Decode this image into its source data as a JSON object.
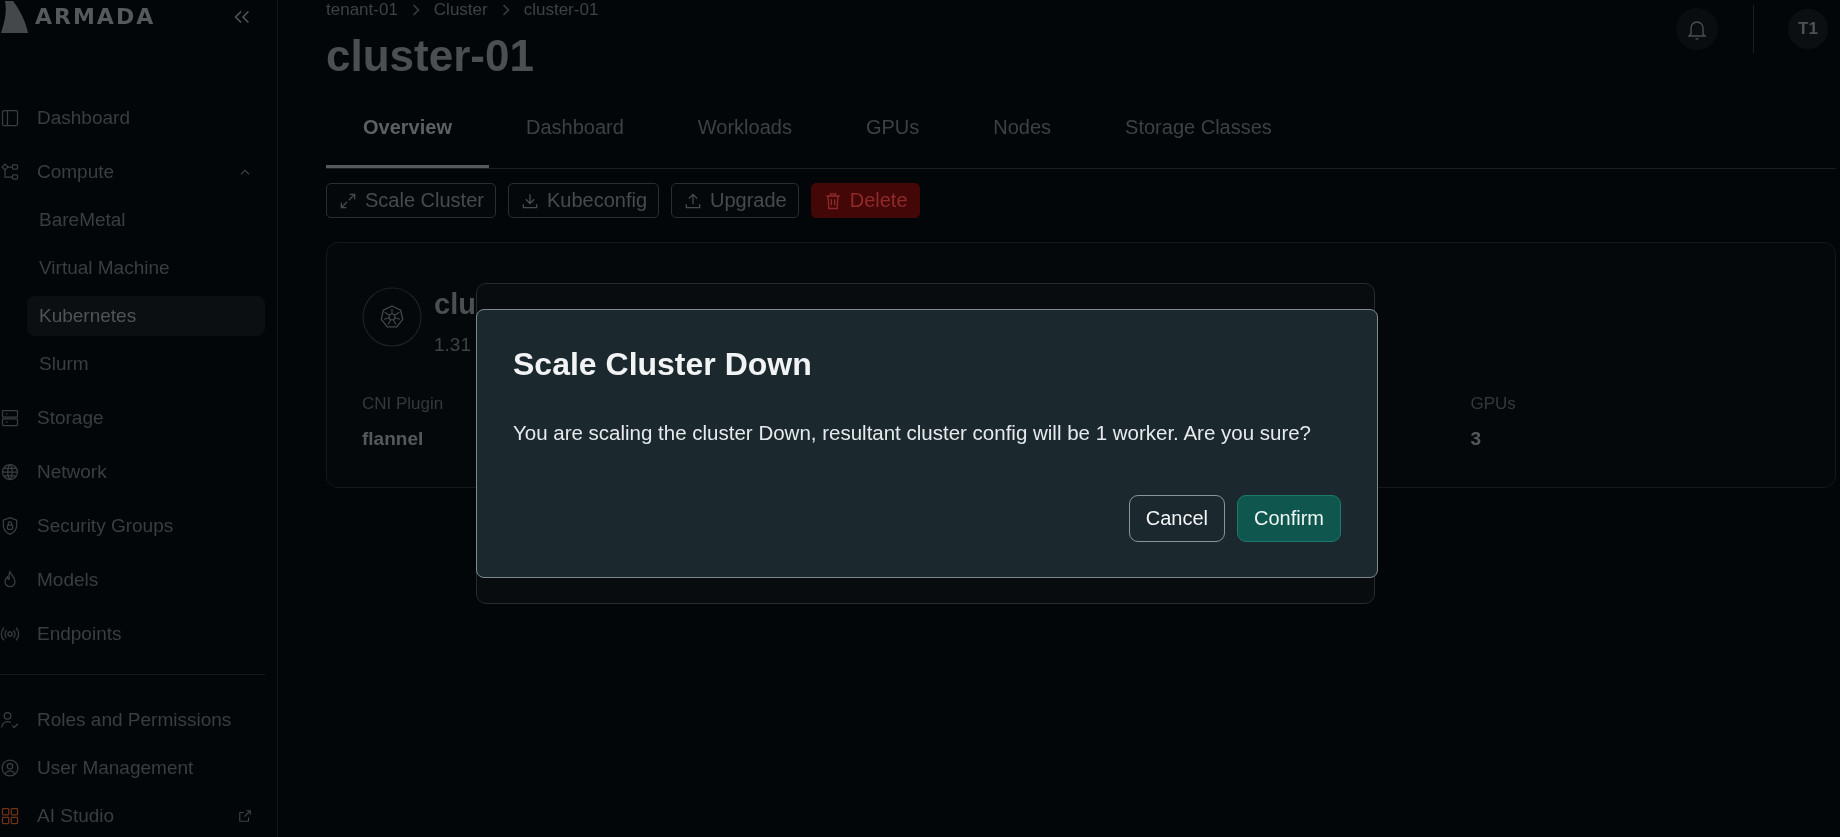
{
  "sidebar": {
    "logo": "ARMADA",
    "items": [
      {
        "label": "Dashboard",
        "kind": "link",
        "selected": false
      },
      {
        "label": "Compute",
        "kind": "group",
        "selected": false,
        "expanded": true,
        "children": [
          {
            "label": "BareMetal",
            "selected": false
          },
          {
            "label": "Virtual Machine",
            "selected": false
          },
          {
            "label": "Kubernetes",
            "selected": true
          },
          {
            "label": "Slurm",
            "selected": false
          }
        ]
      },
      {
        "label": "Storage",
        "kind": "link",
        "selected": false
      },
      {
        "label": "Network",
        "kind": "link",
        "selected": false
      },
      {
        "label": "Security Groups",
        "kind": "link",
        "selected": false
      },
      {
        "label": "Models",
        "kind": "link",
        "selected": false
      },
      {
        "label": "Endpoints",
        "kind": "link",
        "selected": false
      }
    ],
    "bottom_items": [
      {
        "label": "Roles and Permissions",
        "kind": "link",
        "selected": false
      },
      {
        "label": "User Management",
        "kind": "link",
        "selected": false
      },
      {
        "label": "AI Studio",
        "kind": "external",
        "selected": false
      }
    ]
  },
  "header": {
    "breadcrumb": [
      "tenant-01",
      "Cluster",
      "cluster-01"
    ],
    "title": "cluster-01",
    "avatar": "T1"
  },
  "tabs": [
    {
      "label": "Overview",
      "selected": true
    },
    {
      "label": "Dashboard",
      "selected": false
    },
    {
      "label": "Workloads",
      "selected": false
    },
    {
      "label": "GPUs",
      "selected": false
    },
    {
      "label": "Nodes",
      "selected": false
    },
    {
      "label": "Storage Classes",
      "selected": false
    }
  ],
  "actions": [
    {
      "label": "Scale Cluster",
      "kind": "default"
    },
    {
      "label": "Kubeconfig",
      "kind": "default"
    },
    {
      "label": "Upgrade",
      "kind": "default"
    },
    {
      "label": "Delete",
      "kind": "danger"
    }
  ],
  "cluster_card": {
    "name": "clu",
    "version": "1.31",
    "details": [
      {
        "label": "CNI Plugin",
        "value": "flannel"
      },
      {
        "label": "GPUs",
        "value": "3"
      }
    ]
  },
  "dialog": {
    "title": "Scale Cluster Down",
    "message": "You are scaling the cluster Down, resultant cluster config will be 1 worker. Are you sure?",
    "buttons": [
      {
        "label": "Cancel",
        "kind": "secondary"
      },
      {
        "label": "Confirm",
        "kind": "primary"
      }
    ]
  }
}
